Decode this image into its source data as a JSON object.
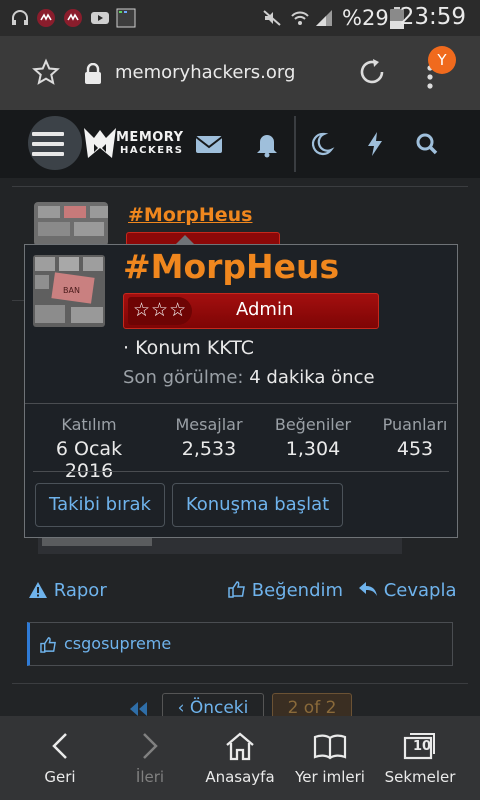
{
  "status_bar": {
    "battery_percent": "%29",
    "time": "23:59"
  },
  "browser": {
    "url": "memoryhackers.org",
    "profile_initial": "Y"
  },
  "site": {
    "logo_top": "MEMORY",
    "logo_bottom": "HACKERS"
  },
  "post_behind": {
    "username": "#MorpHeus"
  },
  "member_card": {
    "username": "#MorpHeus",
    "rank_label": "Admin",
    "rank_stars": "☆☆☆",
    "location": "· Konum KKTC",
    "last_seen_label": "Son görülme:",
    "last_seen_value": "4 dakika önce",
    "stats": [
      {
        "label": "Katılım",
        "value": "6 Ocak 2016"
      },
      {
        "label": "Mesajlar",
        "value": "2,533"
      },
      {
        "label": "Beğeniler",
        "value": "1,304"
      },
      {
        "label": "Puanları",
        "value": "453"
      }
    ],
    "unfollow_label": "Takibi bırak",
    "start_conversation_label": "Konuşma başlat"
  },
  "post_actions": {
    "report_label": "Rapor",
    "like_label": "Beğendim",
    "reply_label": "Cevapla"
  },
  "likes": {
    "user": "csgosupreme"
  },
  "pagination": {
    "prev_label": "Önceki",
    "page_label": "2 of 2"
  },
  "bottom_nav": [
    {
      "label": "Geri"
    },
    {
      "label": "İleri"
    },
    {
      "label": "Anasayfa"
    },
    {
      "label": "Yer imleri"
    },
    {
      "label": "Sekmeler",
      "count": "10"
    }
  ],
  "colors": {
    "accent_orange": "#f0871e",
    "link_blue": "#6fb3ec",
    "rank_red": "#a30f0f"
  }
}
